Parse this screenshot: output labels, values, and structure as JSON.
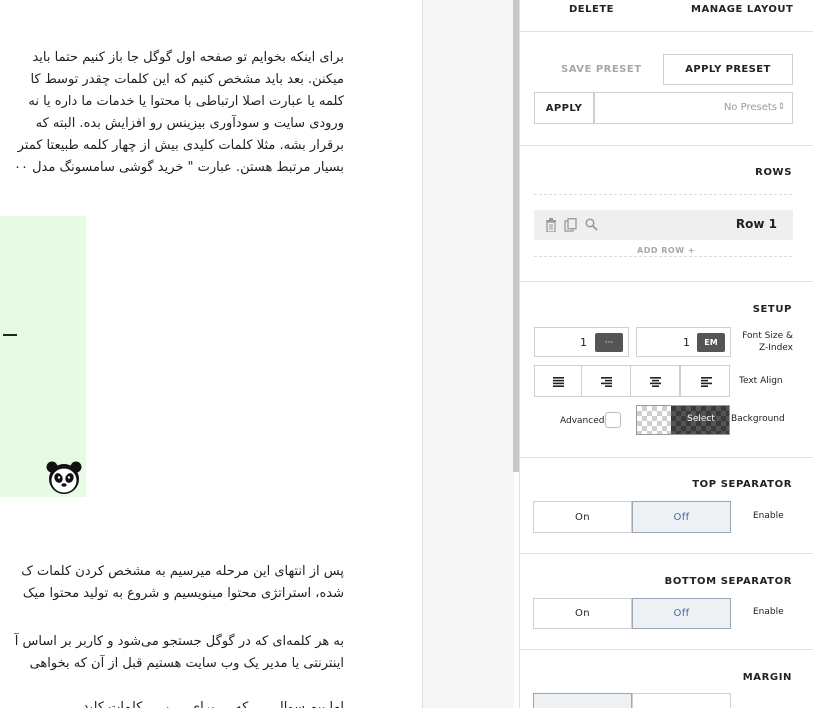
{
  "article": {
    "paragraph1": [
      "برای اینکه بخوایم تو صفحه اول گوگل جا باز کنیم حتما باید",
      "میکنن. بعد باید مشخص کنیم که این کلمات چقدر توسط کا",
      "کلمه یا عبارت اصلا ارتباطی با محتوا یا خدمات ما داره یا نه",
      "ورودی سایت و سودآوری بیزینس رو افزایش بده. البته که",
      "برقرار بشه. مثلا کلمات کلیدی بیش از چهار کلمه طبیعتا کمتر",
      "بسیار مرتبط هستن. عبارت \" خرید گوشی سامسونگ مدل ۰۰"
    ],
    "paragraph2": [
      "پس از انتهای این مرحله میرسیم به مشخص کردن کلمات ک",
      "شده، استراتژی محتوا مینویسیم و شروع به تولید محتوا میک"
    ],
    "paragraph3": [
      "به هر کلمه‌ای که در گوگل جستجو می‌شود و کاربر بر اساس آ",
      "اینترنتی یا مدیر یک وب سایت هستیم قبل از آن که بخواهی"
    ],
    "paragraph4": [
      "اما بیم سوالی ... که ... برای ... ر ... کلمات کلید"
    ]
  },
  "panel": {
    "top": {
      "delete": "DELETE",
      "manage_layout": "MANAGE LAYOUT"
    },
    "preset": {
      "save": "SAVE PRESET",
      "apply_preset": "APPLY PRESET",
      "apply": "APPLY",
      "select_value": "No Presets"
    },
    "rows": {
      "title": "ROWS",
      "row_label": "Row 1",
      "add_row": "ADD ROW +"
    },
    "setup": {
      "title": "SETUP",
      "font_size_value": "1",
      "font_size_unit": "···",
      "zindex_value": "1",
      "zindex_unit": "EM",
      "size_label": "Font Size & Z-Index",
      "align_label": "Text Align",
      "advanced_label": "Advanced",
      "select_label": "Select",
      "background_label": "Background"
    },
    "top_separator": {
      "title": "TOP SEPARATOR",
      "on": "On",
      "off": "Off",
      "enable": "Enable"
    },
    "bottom_separator": {
      "title": "BOTTOM SEPARATOR",
      "on": "On",
      "off": "Off",
      "enable": "Enable"
    },
    "margin": {
      "title": "MARGIN"
    }
  },
  "colors": {
    "off_active_bg": "#eef1f4",
    "off_active_text": "#3a6ea5",
    "green_box": "#e6fae4"
  }
}
